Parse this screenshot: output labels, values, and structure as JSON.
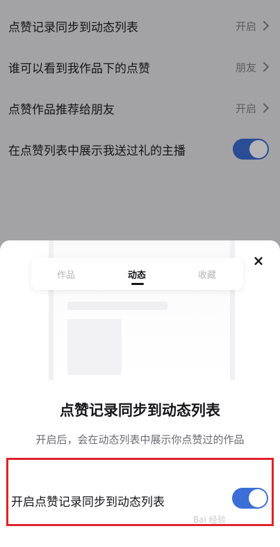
{
  "settings": {
    "rows": [
      {
        "label": "点赞记录同步到动态列表",
        "value": "开启"
      },
      {
        "label": "谁可以看到我作品下的点赞",
        "value": "朋友"
      },
      {
        "label": "点赞作品推荐给朋友",
        "value": "开启"
      },
      {
        "label": "在点赞列表中展示我送过礼的主播",
        "toggle_on": true
      }
    ]
  },
  "sheet": {
    "close": "×",
    "tabs": [
      "作品",
      "动态",
      "收藏"
    ],
    "active_tab": "动态",
    "title": "点赞记录同步到动态列表",
    "description": "开启后，会在动态列表中展示你点赞过的作品",
    "switch_label": "开启点赞记录同步到动态列表",
    "switch_on": true,
    "watermark": "Bai 经验"
  },
  "colors": {
    "accent": "#3b6fd7",
    "highlight": "#e0222a"
  }
}
